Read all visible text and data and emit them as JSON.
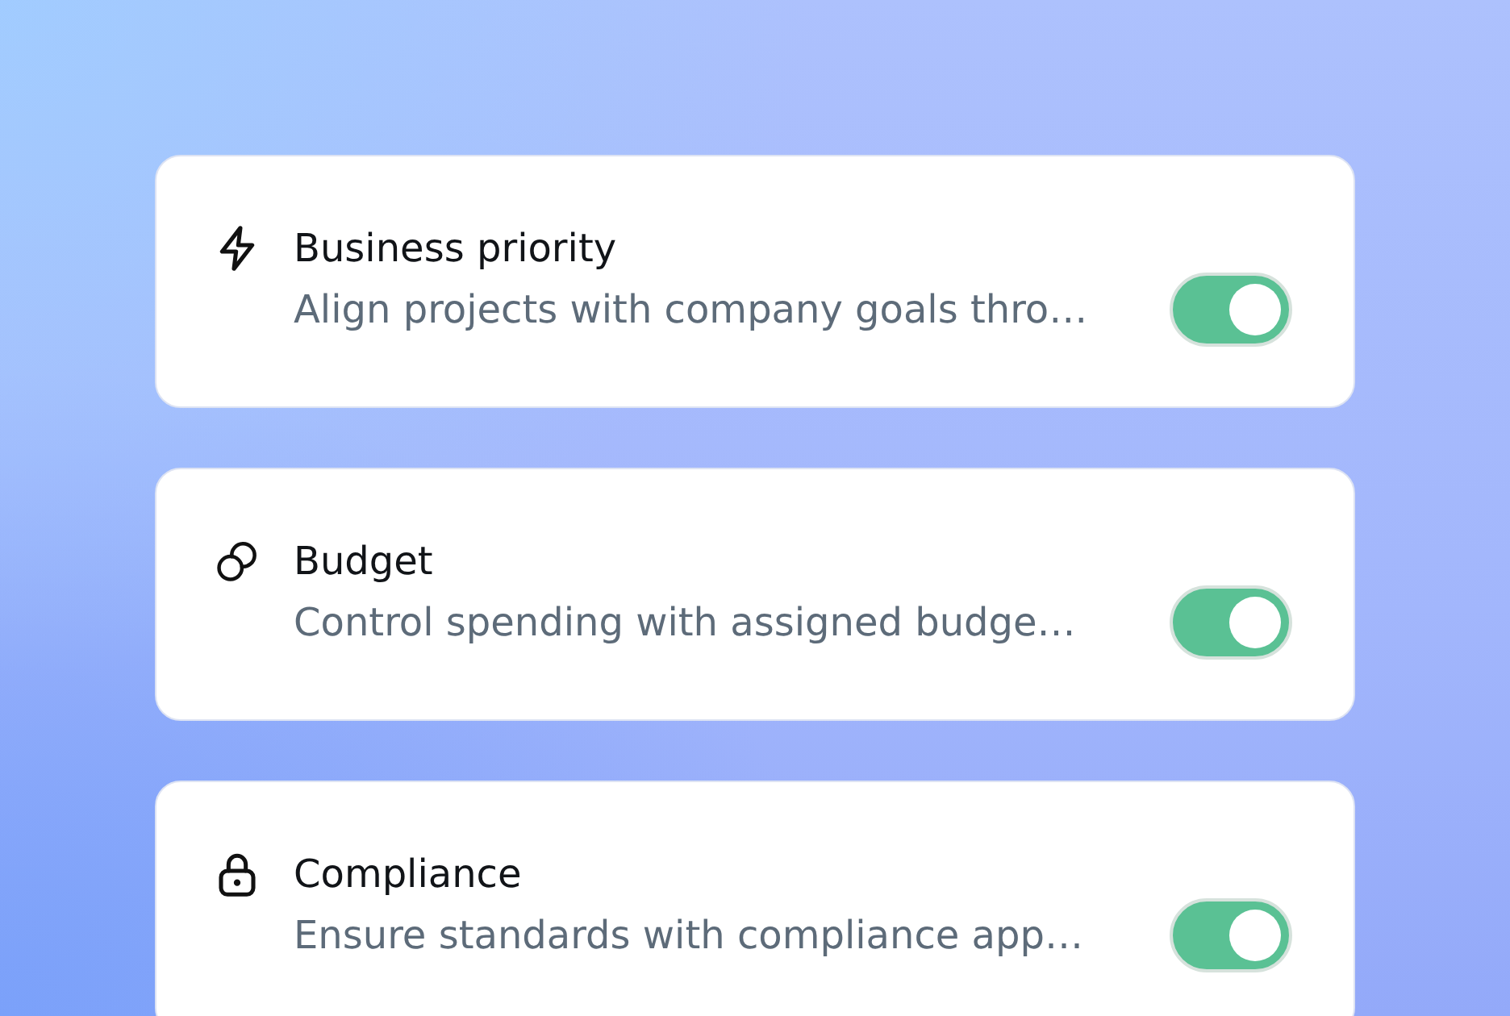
{
  "settings": [
    {
      "kind": "priority",
      "title": "Business priority",
      "description": "Align projects with company goals thro…",
      "on": true
    },
    {
      "kind": "budget",
      "title": "Budget",
      "description": "Control spending with assigned budge…",
      "on": true
    },
    {
      "kind": "compliance",
      "title": "Compliance",
      "description": "Ensure standards with compliance app…",
      "on": true
    }
  ]
}
